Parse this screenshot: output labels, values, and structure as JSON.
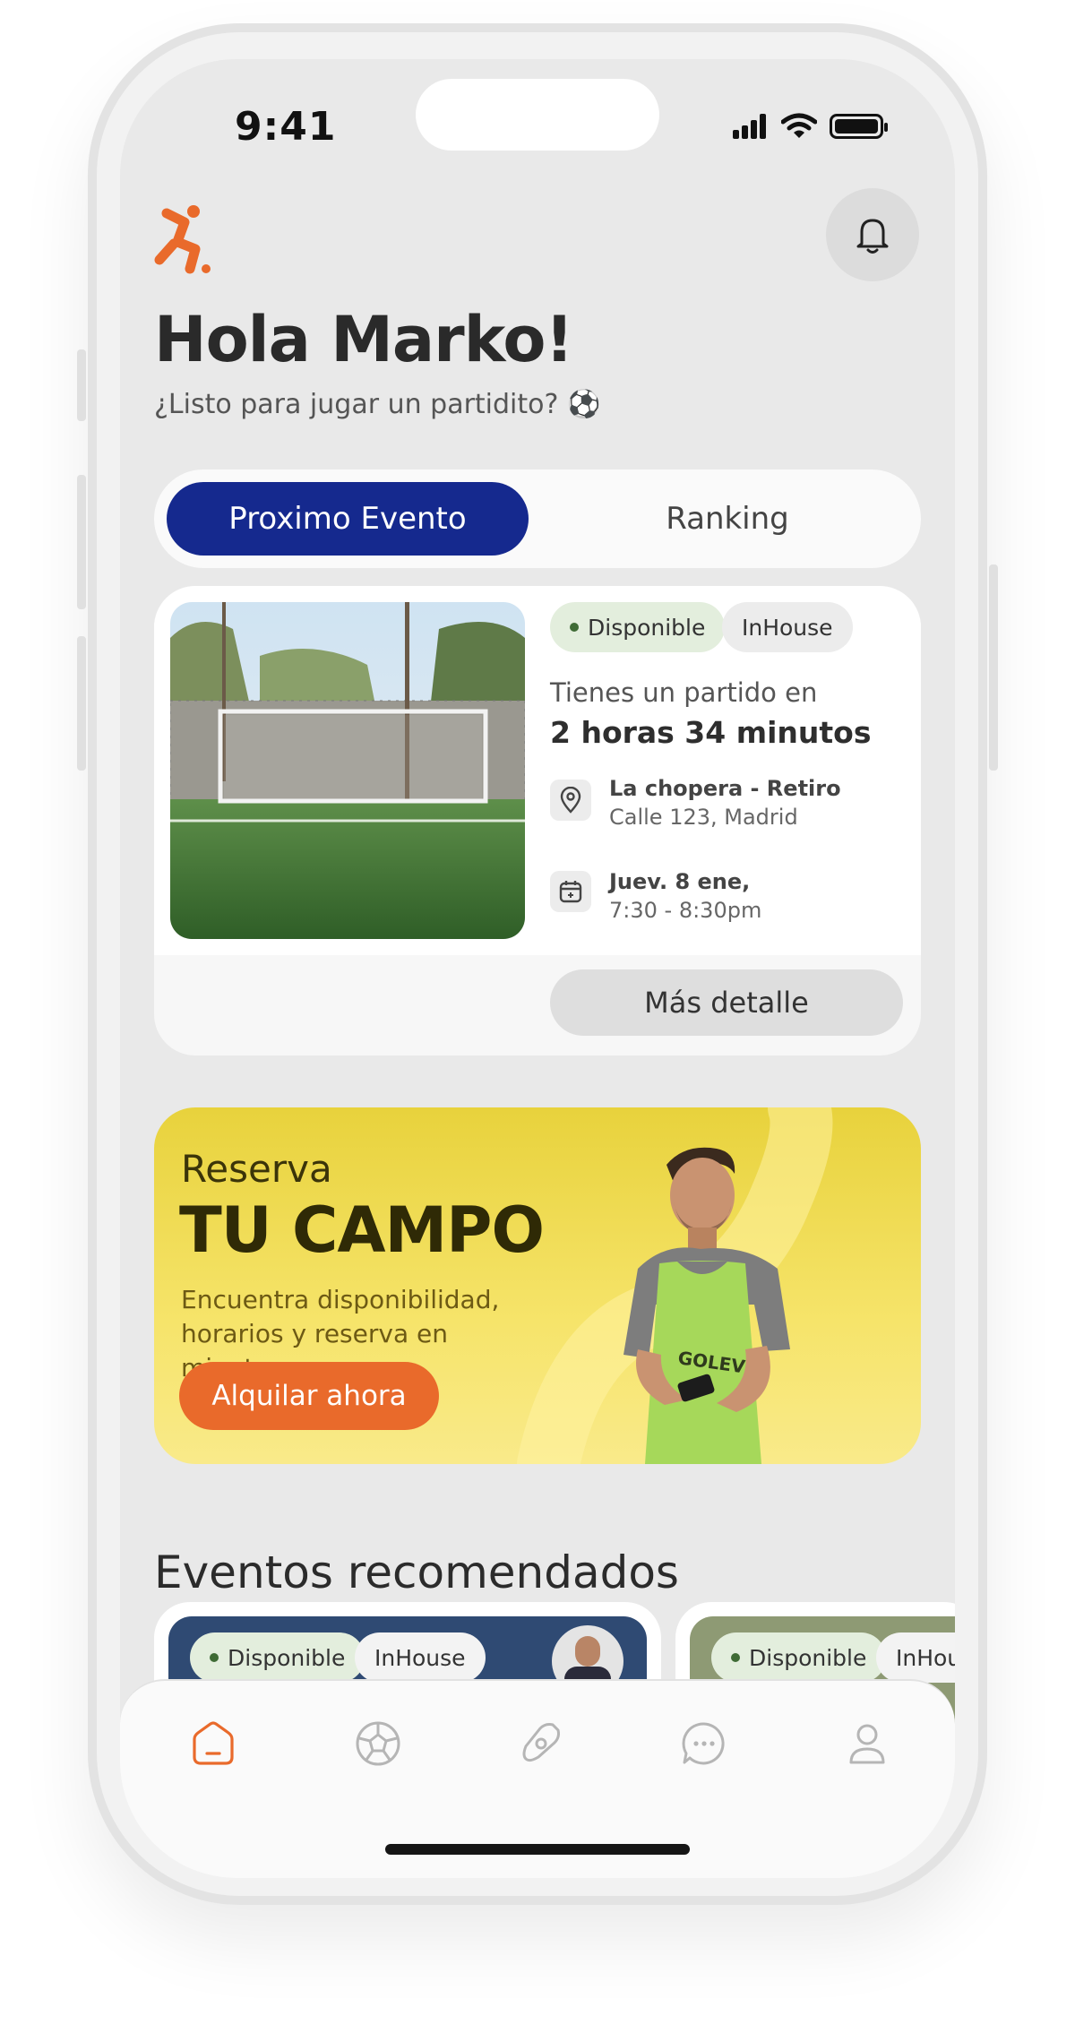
{
  "status_bar": {
    "time": "9:41"
  },
  "header": {
    "greeting": "Hola Marko!",
    "subtitle": "¿Listo para jugar un partidito? ⚽"
  },
  "tabs": [
    {
      "label": "Proximo Evento",
      "active": true
    },
    {
      "label": "Ranking",
      "active": false
    }
  ],
  "event": {
    "badges": [
      "Disponible",
      "InHouse"
    ],
    "countdown_label": "Tienes un partido en",
    "countdown_value": "2 horas 34 minutos",
    "venue_name": "La chopera - Retiro",
    "venue_address": "Calle 123, Madrid",
    "date": "Juev. 8 ene,",
    "time": "7:30 - 8:30pm",
    "details_button": "Más detalle"
  },
  "promo": {
    "line1": "Reserva",
    "line2": "TU CAMPO",
    "description": "Encuentra disponibilidad, horarios y reserva en minutos.",
    "button": "Alquilar ahora",
    "shirt_text": "GOLEVEL"
  },
  "recommended": {
    "title": "Eventos recomendados",
    "cards": [
      {
        "badges": [
          "Disponible",
          "InHouse"
        ]
      },
      {
        "badges": [
          "Disponible",
          "InHous"
        ]
      }
    ]
  },
  "bottom_nav": {
    "items": [
      {
        "icon": "home-icon",
        "active": true
      },
      {
        "icon": "soccer-ball-icon",
        "active": false
      },
      {
        "icon": "explore-icon",
        "active": false
      },
      {
        "icon": "chat-icon",
        "active": false
      },
      {
        "icon": "profile-icon",
        "active": false
      }
    ]
  },
  "colors": {
    "primary": "#15298e",
    "accent": "#e96a2b",
    "promo_yellow": "#f3df52",
    "available_green": "#e3eedd"
  }
}
